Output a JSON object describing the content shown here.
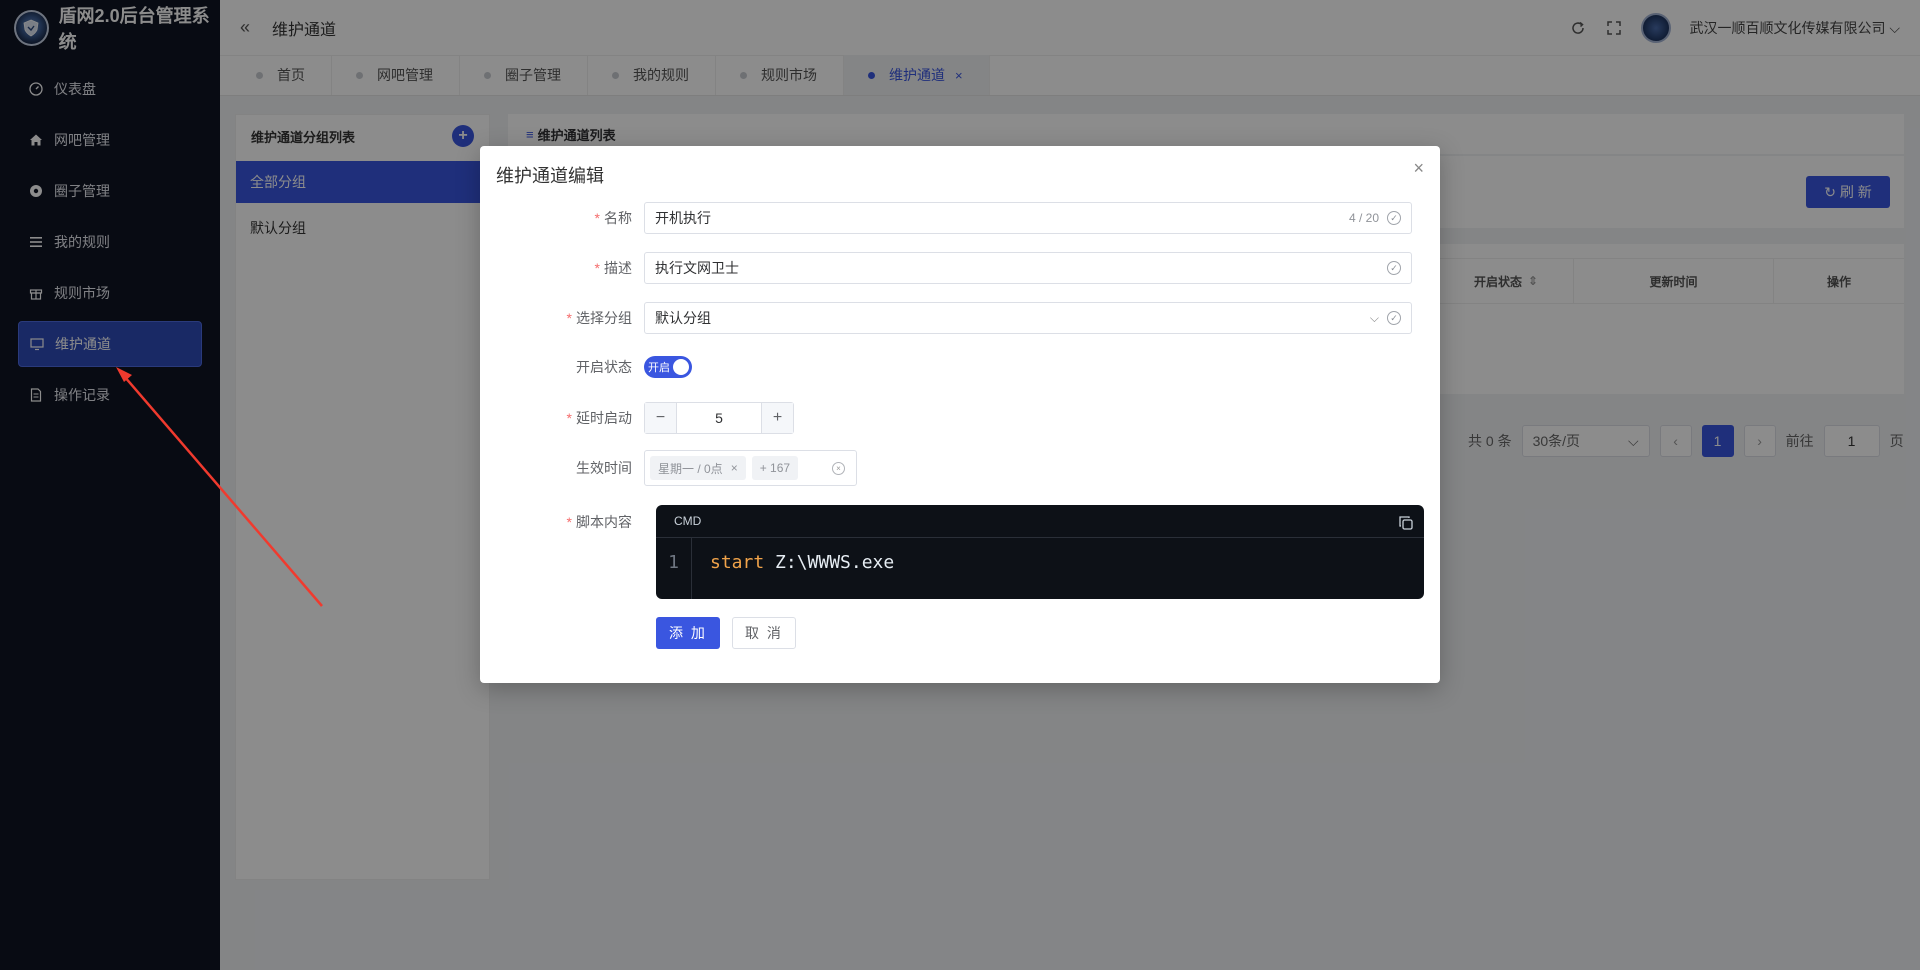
{
  "app": {
    "title": "盾网2.0后台管理系统",
    "company": "武汉一顺百顺文化传媒有限公司"
  },
  "sidebar": {
    "items": [
      {
        "label": "仪表盘",
        "icon": "dashboard-icon"
      },
      {
        "label": "网吧管理",
        "icon": "home-icon"
      },
      {
        "label": "圈子管理",
        "icon": "circle-icon"
      },
      {
        "label": "我的规则",
        "icon": "list-icon"
      },
      {
        "label": "规则市场",
        "icon": "gift-icon"
      },
      {
        "label": "维护通道",
        "icon": "monitor-icon",
        "active": true
      },
      {
        "label": "操作记录",
        "icon": "document-icon"
      }
    ]
  },
  "header": {
    "title": "维护通道"
  },
  "tabs": [
    {
      "label": "首页"
    },
    {
      "label": "网吧管理"
    },
    {
      "label": "圈子管理"
    },
    {
      "label": "我的规则"
    },
    {
      "label": "规则市场"
    },
    {
      "label": "维护通道",
      "active": true,
      "close": "×"
    }
  ],
  "group_panel": {
    "title": "维护通道分组列表",
    "add": "+",
    "groups": [
      "全部分组",
      "默认分组"
    ]
  },
  "list_panel": {
    "title": "维护通道列表",
    "refresh_label": "刷 新",
    "columns": [
      "开启状态",
      "更新时间",
      "操作"
    ]
  },
  "pagination": {
    "total": "共 0 条",
    "page_size": "30条/页",
    "current_page": "1",
    "goto_label": "前往",
    "goto_value": "1",
    "page_suffix": "页",
    "prev": "‹",
    "next": "›"
  },
  "dialog": {
    "title": "维护通道编辑",
    "close": "×",
    "fields": {
      "name": {
        "label": "名称",
        "value": "开机执行",
        "count": "4 / 20"
      },
      "desc": {
        "label": "描述",
        "value": "执行文网卫士"
      },
      "group": {
        "label": "选择分组",
        "value": "默认分组"
      },
      "status": {
        "label": "开启状态",
        "switch_text": "开启",
        "on": true
      },
      "delay": {
        "label": "延时启动",
        "value": "5",
        "minus": "−",
        "plus": "+"
      },
      "schedule": {
        "label": "生效时间",
        "tags": [
          "星期一 / 0点",
          "+ 167"
        ]
      },
      "script": {
        "label": "脚本内容",
        "lang": "CMD",
        "line_number": "1",
        "keyword": "start",
        "rest": " Z:\\WWWS.exe"
      }
    },
    "submit_label": "添 加",
    "cancel_label": "取 消"
  },
  "colors": {
    "primary": "#3a56e0",
    "sidebar_bg": "#0f1423",
    "required": "#f56c6c",
    "arrow": "#f03a2e"
  }
}
